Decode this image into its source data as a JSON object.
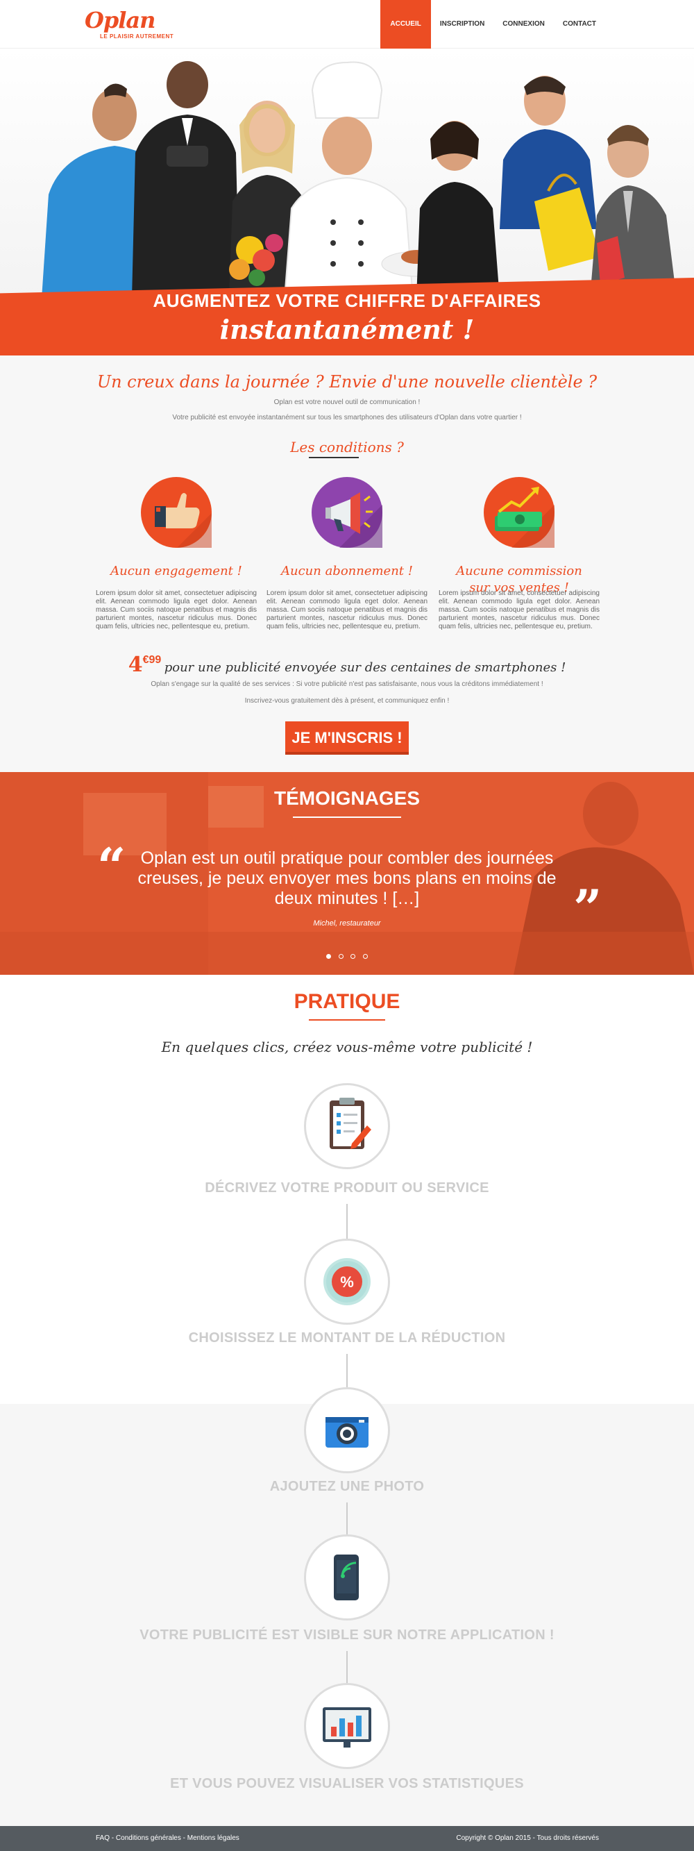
{
  "logo": {
    "name": "Oplan",
    "tagline": "Le plaisir autrement"
  },
  "nav": [
    {
      "label": "Accueil"
    },
    {
      "label": "Inscription"
    },
    {
      "label": "Connexion"
    },
    {
      "label": "Contact"
    }
  ],
  "hero": {
    "title_line1": "AUGMENTEZ VOTRE CHIFFRE D'AFFAIRES",
    "title_line2": "instantanément !"
  },
  "intro": {
    "title": "Un creux dans la journée ? Envie d'une nouvelle clientèle ?",
    "line1": "Oplan est votre nouvel outil de communication !",
    "line2": "Votre publicité est envoyée instantanément  sur tous les smartphones des utilisateurs d'Oplan dans votre quartier !",
    "conditions_title": "Les conditions ?",
    "conditions": [
      {
        "label_line1": "Aucun engagement !",
        "label_line2": "",
        "text": "Lorem ipsum dolor sit amet, consectetuer adipiscing elit. Aenean commodo ligula eget dolor. Aenean massa. Cum sociis natoque penatibus et magnis dis parturient montes, nascetur ridiculus mus. Donec quam felis, ultricies nec, pellentesque eu, pretium."
      },
      {
        "label_line1": "Aucun abonnement !",
        "label_line2": "",
        "text": "Lorem ipsum dolor sit amet, consectetuer adipiscing elit. Aenean commodo ligula eget dolor. Aenean massa. Cum sociis natoque penatibus et magnis dis parturient montes, nascetur ridiculus mus. Donec quam felis, ultricies nec, pellentesque eu, pretium."
      },
      {
        "label_line1": "Aucune commission",
        "label_line2": "sur vos ventes !",
        "text": "Lorem ipsum dolor sit amet, consectetuer adipiscing elit. Aenean commodo ligula eget dolor. Aenean massa. Cum sociis natoque penatibus et magnis dis parturient montes, nascetur ridiculus mus. Donec quam felis, ultricies nec, pellentesque eu, pretium."
      }
    ],
    "price_main": "4",
    "price_cents": "€99",
    "price_text": "pour une publicité envoyée sur des centaines de smartphones !",
    "guarantee": "Oplan s'engage sur la qualité de ses services : Si votre publicité n'est pas satisfaisante, nous vous la créditons immédiatement !",
    "invite": "Inscrivez-vous gratuitement dès à présent, et communiquez enfin !",
    "signup_button": "JE M'INSCRIS !"
  },
  "testimonials": {
    "title": "TÉMOIGNAGES",
    "open_quote": "“",
    "close_quote": "”",
    "quote": "Oplan est un outil pratique pour combler des journées creuses, je peux envoyer mes bons plans en moins de deux minutes ! […]",
    "author": "Michel, restaurateur",
    "active_slide": 1,
    "slide_count": 4
  },
  "pratique": {
    "title": "PRATIQUE",
    "subtitle": "En quelques clics, créez vous-même votre publicité !",
    "steps": [
      {
        "label": "DÉCRIVEZ VOTRE PRODUIT OU SERVICE",
        "icon": "clipboard-icon"
      },
      {
        "label": "CHOISISSEZ LE MONTANT DE LA RÉDUCTION",
        "icon": "percent-badge-icon"
      },
      {
        "label": "AJOUTEZ UNE PHOTO",
        "icon": "camera-icon"
      },
      {
        "label": "VOTRE PUBLICITÉ EST VISIBLE SUR NOTRE APPLICATION !",
        "icon": "smartphone-signal-icon"
      },
      {
        "label": "ET VOUS POUVEZ VISUALISER VOS STATISTIQUES",
        "icon": "statistics-icon"
      }
    ],
    "percent_symbol": "%"
  },
  "footer": {
    "faq": "FAQ",
    "sep": " - ",
    "conditions": "Conditions générales",
    "mentions": "Mentions légales",
    "copyright": "Copyright © Oplan 2015 - Tous droits réservés"
  },
  "colors": {
    "accent": "#ec4d23",
    "footer": "#555b60",
    "step_text": "#cccccc"
  }
}
